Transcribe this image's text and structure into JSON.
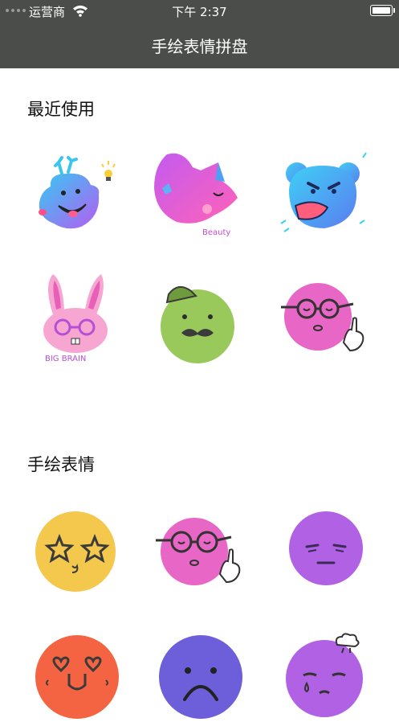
{
  "status_bar": {
    "carrier": "运营商",
    "time": "下午 2:37"
  },
  "nav": {
    "title": "手绘表情拼盘"
  },
  "sections": [
    {
      "title": "最近使用"
    },
    {
      "title": "手绘表情"
    }
  ],
  "recent_stickers": [
    {
      "icon": "blue-deer-face",
      "text": ""
    },
    {
      "icon": "purple-dragon-face",
      "text": "Beauty"
    },
    {
      "icon": "angry-blue-bear",
      "text": ""
    },
    {
      "icon": "pink-bunny-glasses",
      "text": "BIG BRAIN"
    },
    {
      "icon": "green-face-mustache-hat",
      "text": ""
    },
    {
      "icon": "pink-face-glasses-hand",
      "text": ""
    }
  ],
  "hand_drawn_stickers": [
    {
      "icon": "yellow-star-eyes-face"
    },
    {
      "icon": "pink-face-glasses-hand"
    },
    {
      "icon": "purple-unimpressed-face"
    },
    {
      "icon": "orange-heart-eyes-face"
    },
    {
      "icon": "blue-sad-face"
    },
    {
      "icon": "purple-crying-face-cloud"
    }
  ],
  "colors": {
    "header_bg": "#4b4d4a",
    "yellow": "#f3c84d",
    "pink": "#e766c6",
    "purple": "#b061e4",
    "orange": "#f46442",
    "blue_violet": "#6d5fd9",
    "green": "#99c95a"
  }
}
